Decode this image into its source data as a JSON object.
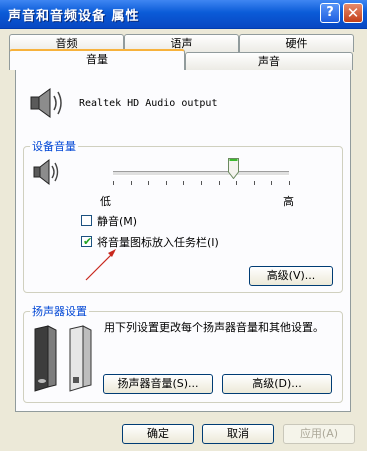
{
  "window": {
    "title": "声音和音频设备 属性",
    "help_glyph": "?",
    "close_glyph": "✕"
  },
  "tabs": {
    "row_back": [
      "音频",
      "语声",
      "硬件"
    ],
    "row_front": [
      "音量",
      "声音"
    ],
    "active": "音量"
  },
  "volume_tab": {
    "device_name": "Realtek HD Audio output",
    "device_volume": {
      "group_title": "设备音量",
      "low_label": "低",
      "high_label": "高",
      "slider_level_fraction": 0.68,
      "mute": {
        "label": "静音(M)",
        "checked": false
      },
      "tray_icon": {
        "label": "将音量图标放入任务栏(I)",
        "checked": true
      },
      "advanced_button": "高级(V)..."
    },
    "speaker_settings": {
      "group_title": "扬声器设置",
      "description": "用下列设置更改每个扬声器音量和其他设置。",
      "speaker_volume_button": "扬声器音量(S)...",
      "advanced_button": "高级(D)..."
    }
  },
  "footer": {
    "ok_button": "确定",
    "cancel_button": "取消",
    "apply_button": "应用(A)"
  },
  "colors": {
    "titlebar": "#0a5bd8",
    "group_title": "#0046d5",
    "annotation_arrow": "#c8281e",
    "check_mark": "#21a121"
  }
}
